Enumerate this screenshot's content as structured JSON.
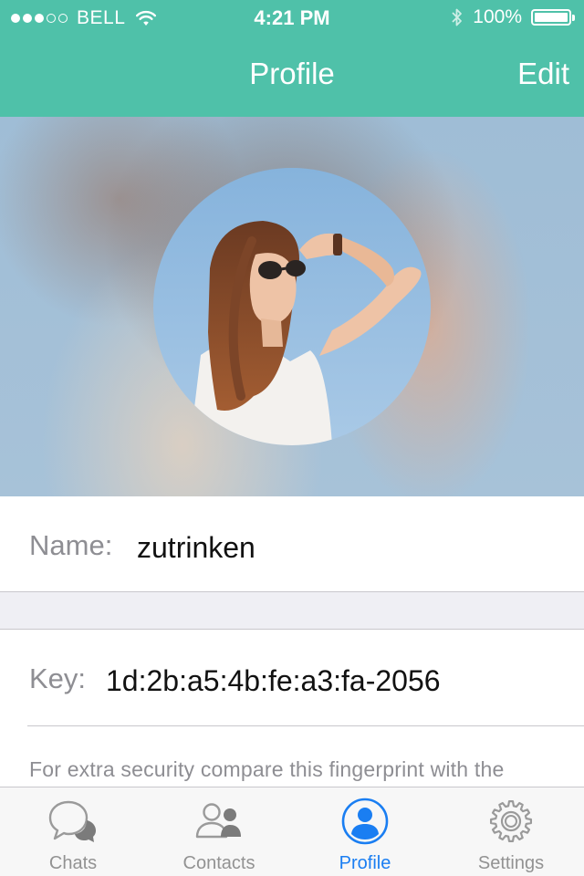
{
  "status_bar": {
    "carrier": "BELL",
    "signal_bars_filled": 3,
    "signal_bars_total": 5,
    "time": "4:21 PM",
    "battery_percent": "100%",
    "battery_level": 1.0
  },
  "nav": {
    "title": "Profile",
    "edit_label": "Edit"
  },
  "profile": {
    "name_label": "Name:",
    "name_value": "zutrinken",
    "key_label": "Key:",
    "key_value": "1d:2b:a5:4b:fe:a3:fa-2056",
    "fingerprint_note": "For extra security compare this fingerprint with the"
  },
  "tabs": [
    {
      "label": "Chats",
      "icon": "chat-bubbles-icon",
      "active": false
    },
    {
      "label": "Contacts",
      "icon": "contacts-icon",
      "active": false
    },
    {
      "label": "Profile",
      "icon": "profile-icon",
      "active": true
    },
    {
      "label": "Settings",
      "icon": "gear-icon",
      "active": false
    }
  ],
  "colors": {
    "accent": "#4fc1a9",
    "tab_active": "#1a7ef2",
    "tab_inactive": "#929292",
    "label_gray": "#8e8e93"
  }
}
